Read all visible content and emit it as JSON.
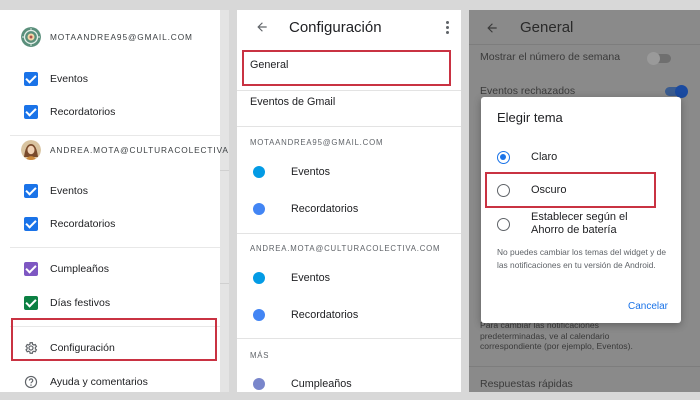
{
  "colors": {
    "accent_red": "#c93242",
    "checkbox_blue": "#1a73e8",
    "checkbox_purple": "#7e57c2",
    "checkbox_teal": "#0b8043",
    "dot_cyan": "#039be5",
    "dot_blue": "#4285f4",
    "dot_lavender": "#7986cb",
    "link_blue": "#1a73e8"
  },
  "drawer": {
    "account1": {
      "email": "MOTAANDREA95@GMAIL.COM",
      "avatar_icon": "mandala-avatar-icon"
    },
    "account1_items": [
      {
        "label": "Eventos",
        "color": "#1a73e8"
      },
      {
        "label": "Recordatorios",
        "color": "#1a73e8"
      }
    ],
    "account2": {
      "email": "ANDREA.MOTA@CULTURACOLECTIVA...",
      "avatar_icon": "profile-photo-avatar-icon"
    },
    "account2_items": [
      {
        "label": "Eventos",
        "color": "#1a73e8"
      },
      {
        "label": "Recordatorios",
        "color": "#1a73e8"
      }
    ],
    "other_items": [
      {
        "label": "Cumpleaños",
        "color": "#7e57c2"
      },
      {
        "label": "Días festivos",
        "color": "#0b8043"
      }
    ],
    "settings_label": "Configuración",
    "settings_icon": "gear-icon",
    "help_label": "Ayuda y comentarios",
    "help_icon": "help-circle-icon"
  },
  "settings": {
    "title": "Configuración",
    "back_icon": "arrow-back-icon",
    "more_icon": "more-vert-icon",
    "general_label": "General",
    "gmail_events_label": "Eventos de Gmail",
    "account1": "MOTAANDREA95@GMAIL.COM",
    "account1_items": [
      {
        "label": "Eventos",
        "color": "#039be5"
      },
      {
        "label": "Recordatorios",
        "color": "#4285f4"
      }
    ],
    "account2": "ANDREA.MOTA@CULTURACOLECTIVA.COM",
    "account2_items": [
      {
        "label": "Eventos",
        "color": "#039be5"
      },
      {
        "label": "Recordatorios",
        "color": "#4285f4"
      }
    ],
    "more_section": "MÁS",
    "more_items": [
      {
        "label": "Cumpleaños",
        "color": "#7986cb"
      }
    ]
  },
  "general": {
    "title": "General",
    "back_icon": "arrow-back-icon",
    "show_week_number": "Mostrar el número de semana",
    "declined_events": "Eventos rechazados",
    "notif_note": [
      "Para cambiar las notificaciones",
      "predeterminadas, ve al calendario",
      "correspondiente (por ejemplo, Eventos)."
    ],
    "quick_responses": "Respuestas rápidas"
  },
  "theme_dialog": {
    "title": "Elegir tema",
    "options": [
      {
        "label": "Claro",
        "selected": true
      },
      {
        "label": "Oscuro",
        "selected": false
      },
      {
        "label": "Establecer según el Ahorro de batería",
        "selected": false
      }
    ],
    "option3_line1": "Establecer según el",
    "option3_line2": "Ahorro de batería",
    "note": "No puedes cambiar los temas del widget y de las notificaciones en tu versión de Android.",
    "cancel_label": "Cancelar"
  }
}
